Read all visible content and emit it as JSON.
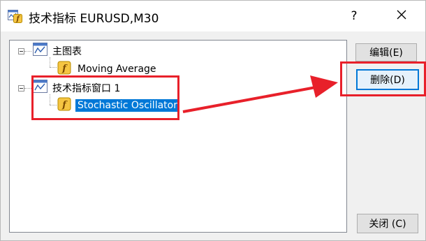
{
  "window": {
    "title": "技术指标 EURUSD,M30"
  },
  "titlebar": {
    "help_label": "?"
  },
  "tree": {
    "nodes": [
      {
        "label": "主图表"
      },
      {
        "label": "Moving Average"
      },
      {
        "label": "技术指标窗口 1"
      },
      {
        "label": "Stochastic Oscillator"
      }
    ]
  },
  "buttons": {
    "edit": "编辑(E)",
    "delete": "删除(D)",
    "close": "关闭 (C)"
  },
  "colors": {
    "selection": "#0078d7",
    "annotation": "#e8202a"
  }
}
